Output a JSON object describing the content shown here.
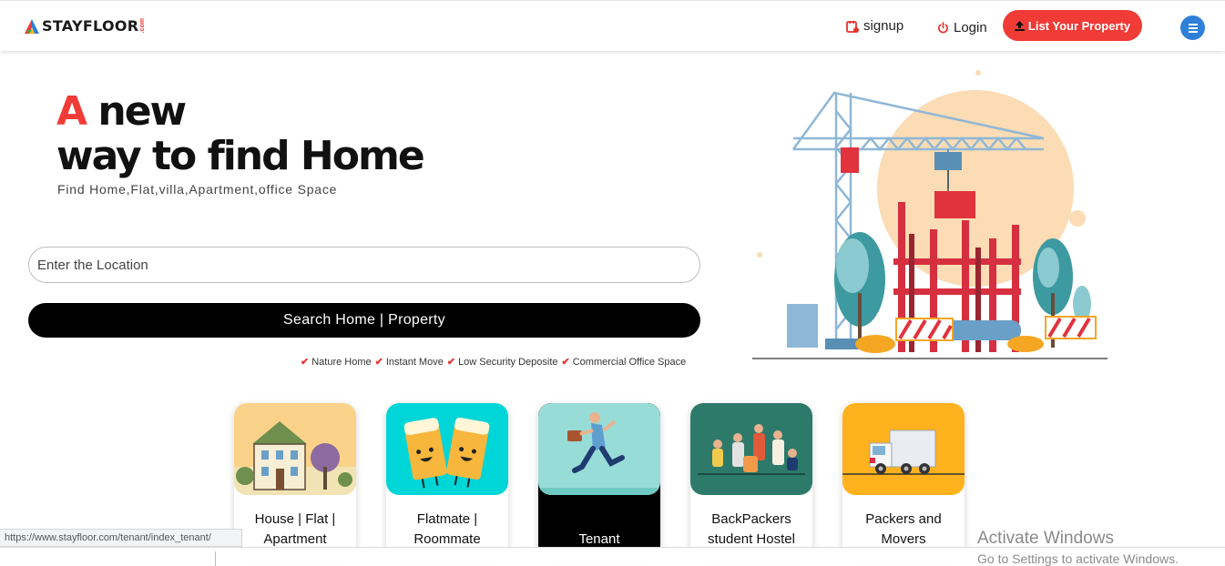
{
  "header": {
    "logo_text": "STAYFLOOR",
    "logo_suffix": ".com",
    "signup_label": "signup",
    "login_label": "Login",
    "list_property_label": "List Your Property",
    "accent_color": "#f03b36",
    "menu_color": "#2f80d9"
  },
  "hero": {
    "title_a": "A",
    "title_rest_line1": "new",
    "title_line2": "way to find Home",
    "subtitle": "Find Home,Flat,villa,Apartment,office Space"
  },
  "search": {
    "placeholder": "Enter the Location",
    "value": "",
    "button_label": "Search Home | Property"
  },
  "features": [
    "Nature Home",
    "Instant Move",
    "Low Security Deposite",
    "Commercial Office Space"
  ],
  "categories": [
    {
      "label_line1": "House | Flat |",
      "label_line2": "Apartment",
      "icon": "house-illustration",
      "bg": "#fbd28a"
    },
    {
      "label_line1": "Flatmate |",
      "label_line2": "Roommate",
      "icon": "beer-mugs-illustration",
      "bg": "#00d5d7"
    },
    {
      "label_line1": "",
      "label_line2": "Tenant",
      "icon": "running-man-illustration",
      "bg": "#98dcd8"
    },
    {
      "label_line1": "BackPackers",
      "label_line2": "student Hostel",
      "icon": "backpackers-group-illustration",
      "bg": "#2e7a6a"
    },
    {
      "label_line1": "Packers and",
      "label_line2": "Movers",
      "icon": "moving-truck-illustration",
      "bg": "#ffb21d"
    }
  ],
  "status_url": "https://www.stayfloor.com/tenant/index_tenant/",
  "watermark": {
    "line1": "Activate Windows",
    "line2": "Go to Settings to activate Windows."
  }
}
